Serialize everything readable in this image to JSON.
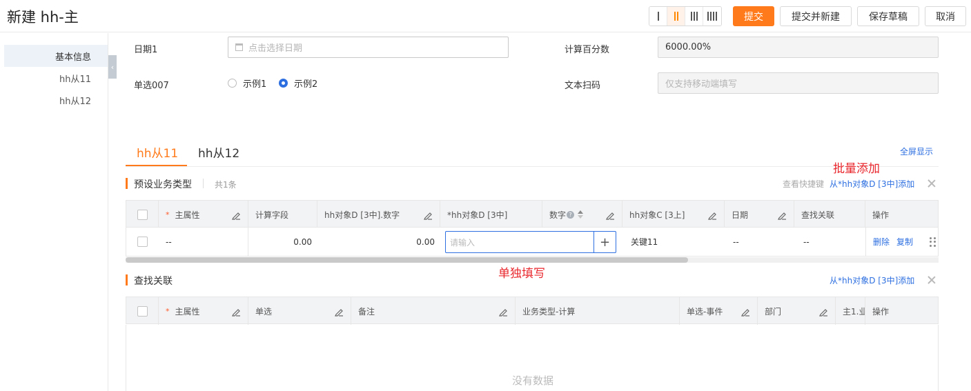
{
  "header": {
    "title": "新建 hh-主",
    "layout_options": [
      "1",
      "2",
      "3",
      "4"
    ],
    "active_layout": "2",
    "buttons": {
      "submit": "提交",
      "submit_new": "提交并新建",
      "save_draft": "保存草稿",
      "cancel": "取消"
    },
    "colors": {
      "primary": "#ff7a1a",
      "link": "#2d6fe0",
      "annotation": "#e8262c"
    }
  },
  "sidebar": {
    "items": [
      {
        "label": "基本信息",
        "active": true
      },
      {
        "label": "hh从11",
        "active": false
      },
      {
        "label": "hh从12",
        "active": false
      }
    ],
    "collapse_icon": "chevron-left-icon"
  },
  "form": {
    "date_label": "日期1",
    "date_placeholder": "点击选择日期",
    "percent_label": "计算百分数",
    "percent_value": "6000.00%",
    "radio_label": "单选007",
    "radio_options": [
      "示例1",
      "示例2"
    ],
    "radio_selected": "示例2",
    "scan_label": "文本扫码",
    "scan_placeholder": "仅支持移动端填写"
  },
  "tabs": {
    "items": [
      "hh从11",
      "hh从12"
    ],
    "active": "hh从11",
    "fullscreen": "全屏显示"
  },
  "annotations": {
    "batch_add": "批量添加",
    "single_fill": "单独填写"
  },
  "section1": {
    "title": "预设业务类型",
    "count": "共1条",
    "shortcut": "查看快捷键",
    "add_from": "从*hh对象D [3中]添加",
    "columns": [
      "主属性",
      "计算字段",
      "hh对象D [3中].数字",
      "*hh对象D [3中]",
      "数字",
      "hh对象C [3上]",
      "日期",
      "查找关联",
      "操作"
    ],
    "row": {
      "main": "--",
      "calc": "0.00",
      "d_number": "0.00",
      "d_obj_placeholder": "请输入",
      "c_obj": "关键11",
      "date": "--",
      "lookup": "--",
      "delete": "删除",
      "copy": "复制"
    }
  },
  "section2": {
    "title": "查找关联",
    "add_from": "从*hh对象D [3中]添加",
    "columns": [
      "主属性",
      "单选",
      "备注",
      "业务类型-计算",
      "单选-事件",
      "部门",
      "主1.业",
      "操作"
    ],
    "empty": "没有数据"
  }
}
